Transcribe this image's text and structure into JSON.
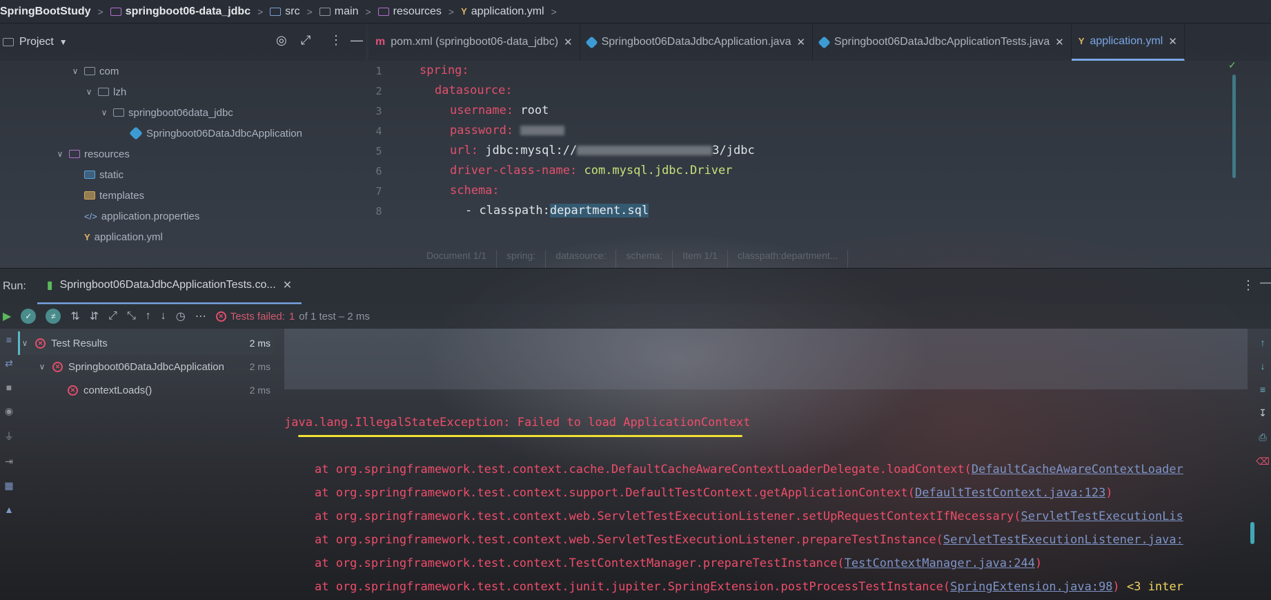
{
  "breadcrumb": [
    {
      "label": "SpringBootStudy",
      "icon": "none",
      "bold": true
    },
    {
      "label": "springboot06-data_jdbc",
      "icon": "module-folder-icon",
      "bold": true
    },
    {
      "label": "src",
      "icon": "source-folder-icon"
    },
    {
      "label": "main",
      "icon": "folder-icon"
    },
    {
      "label": "resources",
      "icon": "resources-folder-icon"
    },
    {
      "label": "application.yml",
      "icon": "yaml-file-icon"
    }
  ],
  "project": {
    "title": "Project",
    "tree": [
      {
        "label": "com",
        "icon": "folder-icon",
        "expanded": true
      },
      {
        "label": "lzh",
        "icon": "folder-icon",
        "expanded": true
      },
      {
        "label": "springboot06data_jdbc",
        "icon": "folder-icon",
        "expanded": true
      },
      {
        "label": "Springboot06DataJdbcApplication",
        "icon": "spring-class-icon"
      },
      {
        "label": "resources",
        "icon": "resources-folder-icon",
        "expanded": true
      },
      {
        "label": "static",
        "icon": "static-folder-icon"
      },
      {
        "label": "templates",
        "icon": "templates-folder-icon"
      },
      {
        "label": "application.properties",
        "icon": "properties-file-icon"
      },
      {
        "label": "application.yml",
        "icon": "yaml-file-icon"
      }
    ]
  },
  "editor": {
    "tabs": [
      {
        "label": "pom.xml (springboot06-data_jdbc)",
        "icon": "maven-icon",
        "active": false
      },
      {
        "label": "Springboot06DataJdbcApplication.java",
        "icon": "spring-class-icon",
        "active": false
      },
      {
        "label": "Springboot06DataJdbcApplicationTests.java",
        "icon": "spring-class-icon",
        "active": false
      },
      {
        "label": "application.yml",
        "icon": "yaml-file-icon",
        "active": true
      }
    ],
    "line_numbers": [
      "1",
      "2",
      "3",
      "4",
      "5",
      "6",
      "7",
      "8"
    ],
    "code": {
      "l1_key": "spring:",
      "l2_key": "datasource:",
      "l3_key": "username:",
      "l3_val": "root",
      "l4_key": "password:",
      "l5_key": "url:",
      "l5_val_a": "jdbc:mysql://",
      "l5_val_b": "3/jdbc",
      "l6_key": "driver-class-name:",
      "l6_val": "com.mysql.jdbc.Driver",
      "l7_key": "schema:",
      "l8_dash": "- classpath:",
      "l8_sel": "department.sql"
    },
    "structure_breadcrumb": [
      "Document 1/1",
      "spring:",
      "datasource:",
      "schema:",
      "Item 1/1",
      "classpath:department..."
    ]
  },
  "run": {
    "label": "Run:",
    "tab_label": "Springboot06DataJdbcApplicationTests.co...",
    "status_prefix": "Tests failed:",
    "status_count": "1",
    "status_suffix": "of 1 test – 2 ms",
    "results": [
      {
        "label": "Test Results",
        "time": "2 ms"
      },
      {
        "label": "Springboot06DataJdbcApplication",
        "time": "2 ms"
      },
      {
        "label": "contextLoads()",
        "time": "2 ms"
      }
    ],
    "console": {
      "exception": "java.lang.IllegalStateException: Failed to load ApplicationContext",
      "trace": [
        {
          "text": "at org.springframework.test.context.cache.DefaultCacheAwareContextLoaderDelegate.loadContext(",
          "link": "DefaultCacheAwareContextLoader",
          "tail": ""
        },
        {
          "text": "at org.springframework.test.context.support.DefaultTestContext.getApplicationContext(",
          "link": "DefaultTestContext.java:123",
          "tail": ")"
        },
        {
          "text": "at org.springframework.test.context.web.ServletTestExecutionListener.setUpRequestContextIfNecessary(",
          "link": "ServletTestExecutionLis",
          "tail": ""
        },
        {
          "text": "at org.springframework.test.context.web.ServletTestExecutionListener.prepareTestInstance(",
          "link": "ServletTestExecutionListener.java:",
          "tail": ""
        },
        {
          "text": "at org.springframework.test.context.TestContextManager.prepareTestInstance(",
          "link": "TestContextManager.java:244",
          "tail": ")"
        },
        {
          "text": "at org.springframework.test.context.junit.jupiter.SpringExtension.postProcessTestInstance(",
          "link": "SpringExtension.java:98",
          "tail": ")",
          "more": "<3 inter"
        }
      ]
    }
  },
  "colors": {
    "error": "#ef4d6a",
    "link": "#7f94c8",
    "accent": "#7aa6e6",
    "yaml_key": "#e2506c",
    "yaml_class": "#c6e37a",
    "annotation_underline": "#f2e033"
  }
}
